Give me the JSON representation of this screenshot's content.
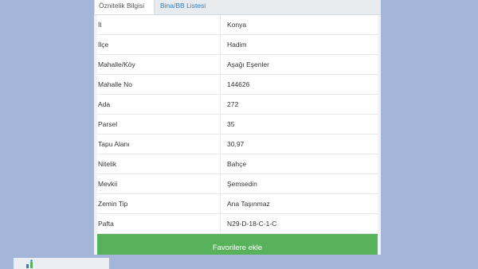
{
  "tabs": {
    "active_label": "Öznitelik Bilgisi",
    "second_label": "Bina/BB Listesi"
  },
  "attributes": [
    {
      "key": "İl",
      "value": "Konya"
    },
    {
      "key": "İlçe",
      "value": "Hadim"
    },
    {
      "key": "Mahalle/Köy",
      "value": "Aşağı Eşenler"
    },
    {
      "key": "Mahalle No",
      "value": "144626"
    },
    {
      "key": "Ada",
      "value": "272"
    },
    {
      "key": "Parsel",
      "value": "35"
    },
    {
      "key": "Tapu Alanı",
      "value": "30,97"
    },
    {
      "key": "Nitelik",
      "value": "Bahçe"
    },
    {
      "key": "Mevkii",
      "value": "Şemsedin"
    },
    {
      "key": "Zemin Tip",
      "value": "Ana Taşınmaz"
    },
    {
      "key": "Pafta",
      "value": "N29-D-18-C-1-C"
    }
  ],
  "actions": {
    "favorite_label": "Favorilere ekle",
    "favorite_color": "#57b25b"
  },
  "colors": {
    "background": "#a3b5d9",
    "link": "#2f7ec3"
  },
  "logo": {
    "icon": "logo-icon"
  }
}
